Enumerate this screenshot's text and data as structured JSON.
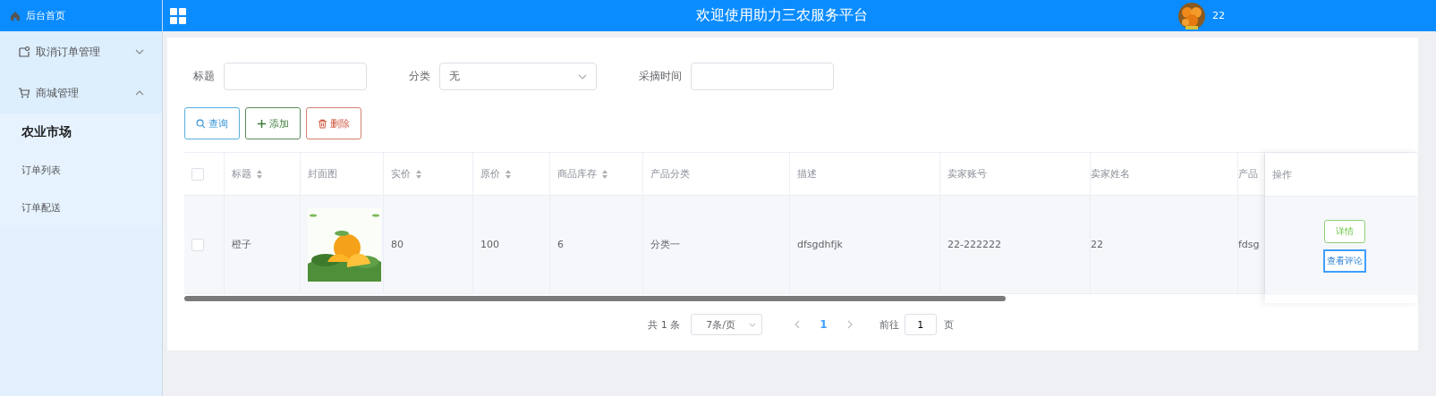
{
  "sidebar": {
    "home": "后台首页",
    "groups": [
      {
        "label": "取消订单管理",
        "expanded": false
      },
      {
        "label": "商城管理",
        "expanded": true,
        "children": [
          {
            "label": "农业市场",
            "selected": true
          },
          {
            "label": "订单列表",
            "selected": false
          },
          {
            "label": "订单配送",
            "selected": false
          }
        ]
      }
    ]
  },
  "header": {
    "title": "欢迎使用助力三农服务平台",
    "user": "22"
  },
  "filters": [
    {
      "label": "标题",
      "kind": "input"
    },
    {
      "label": "分类",
      "kind": "select",
      "value": "无"
    },
    {
      "label": "采摘时间",
      "kind": "input"
    }
  ],
  "actions": [
    {
      "label": "查询",
      "kind": "search"
    },
    {
      "label": "添加",
      "kind": "add"
    },
    {
      "label": "删除",
      "kind": "delete"
    }
  ],
  "table": {
    "all_checked": false,
    "columns": [
      {
        "label": "标题",
        "sortable": true
      },
      {
        "label": "封面图",
        "sortable": false
      },
      {
        "label": "实价",
        "sortable": true
      },
      {
        "label": "原价",
        "sortable": true
      },
      {
        "label": "商品库存",
        "sortable": true
      },
      {
        "label": "产品分类",
        "sortable": false
      },
      {
        "label": "描述",
        "sortable": false
      },
      {
        "label": "卖家账号",
        "sortable": false
      },
      {
        "label": "卖家姓名",
        "sortable": false
      },
      {
        "label": "产品",
        "sortable": false
      }
    ],
    "action_column": "操作",
    "rows": [
      {
        "checked": false,
        "cells": [
          "橙子",
          {
            "kind": "picture"
          },
          "80",
          "100",
          "6",
          "分类一",
          "dfsgdhfjk",
          "22-222222",
          "22",
          "fdsg"
        ],
        "buttons": [
          {
            "label": "详情",
            "kind": "detail"
          },
          {
            "label": "查看评论",
            "kind": "comments"
          }
        ]
      }
    ]
  },
  "pagination": {
    "total": "共 1 条",
    "page_size": "7条/页",
    "pages": [
      {
        "label": "1",
        "selected": true
      }
    ],
    "goto_label": "前往",
    "goto_value": "1",
    "goto_suffix": "页"
  }
}
